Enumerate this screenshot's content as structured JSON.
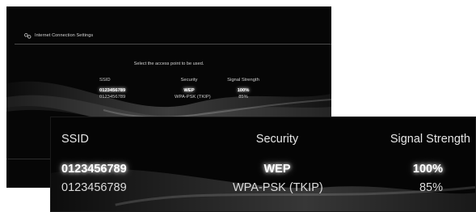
{
  "screen": {
    "title": "Internet Connection Settings",
    "icon": "network-settings-icon",
    "instruction": "Select the access point to be used."
  },
  "table": {
    "headers": {
      "ssid": "SSID",
      "security": "Security",
      "signal": "Signal Strength"
    },
    "rows": [
      {
        "ssid": "0123456789",
        "security": "WEP",
        "signal": "100%",
        "selected": true
      },
      {
        "ssid": "0123456789",
        "security": "WPA-PSK (TKIP)",
        "signal": "85%",
        "selected": false
      }
    ]
  },
  "colors": {
    "background": "#060606",
    "text": "#d8d8d8",
    "highlight_glow": "#ffffff"
  }
}
